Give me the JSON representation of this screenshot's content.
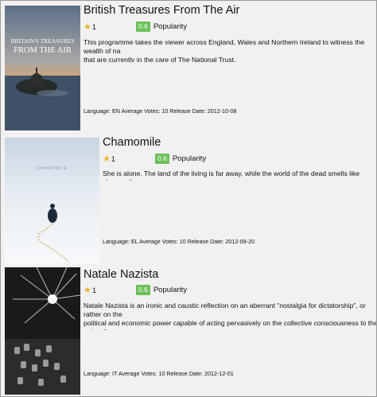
{
  "items": [
    {
      "title": "British Treasures From The Air",
      "rating": "1",
      "popularity_value": "0.6",
      "popularity_label": "Popularity",
      "description": "This programme takes the viewer across England, Wales and Northern Ireland to witness the wealth of na\nthat are currently in the care of The National Trust.",
      "language_label": "Language:",
      "language": "EN",
      "votes_label": "Average Votes:",
      "votes": "10",
      "date_label": "Release Date:",
      "date": "2012-10-08",
      "poster_text_1": "BRITAIN'S TREASURES",
      "poster_text_2": "FROM THE AIR"
    },
    {
      "title": "Chamomile",
      "rating": "1",
      "popularity_value": "0.6",
      "popularity_label": "Popularity",
      "description": "She is alone. The land of the living is far away, while the world of the dead smells like chamomile.",
      "language_label": "Language:",
      "language": "EL",
      "votes_label": "Average Votes:",
      "votes": "10",
      "date_label": "Release Date:",
      "date": "2012-09-20",
      "poster_text_1": "CHAMOMILE"
    },
    {
      "title": "Natale Nazista",
      "rating": "1",
      "popularity_value": "0.6",
      "popularity_label": "Popularity",
      "description": "Natale Nazista is an ironic and caustic reflection on an aberrant \"nostalgia for dictatorship\", or rather on the\npolitical and economic power capable of acting pervasively on the collective consciousness to the point of\nand convinced acceptance.",
      "language_label": "Language:",
      "language": "IT",
      "votes_label": "Average Votes:",
      "votes": "10",
      "date_label": "Release Date:",
      "date": "2012-12-01"
    }
  ],
  "icons": {
    "rating": "star-icon"
  },
  "colors": {
    "popularity_badge": "#6cc05a",
    "star": "#e8b52a"
  }
}
